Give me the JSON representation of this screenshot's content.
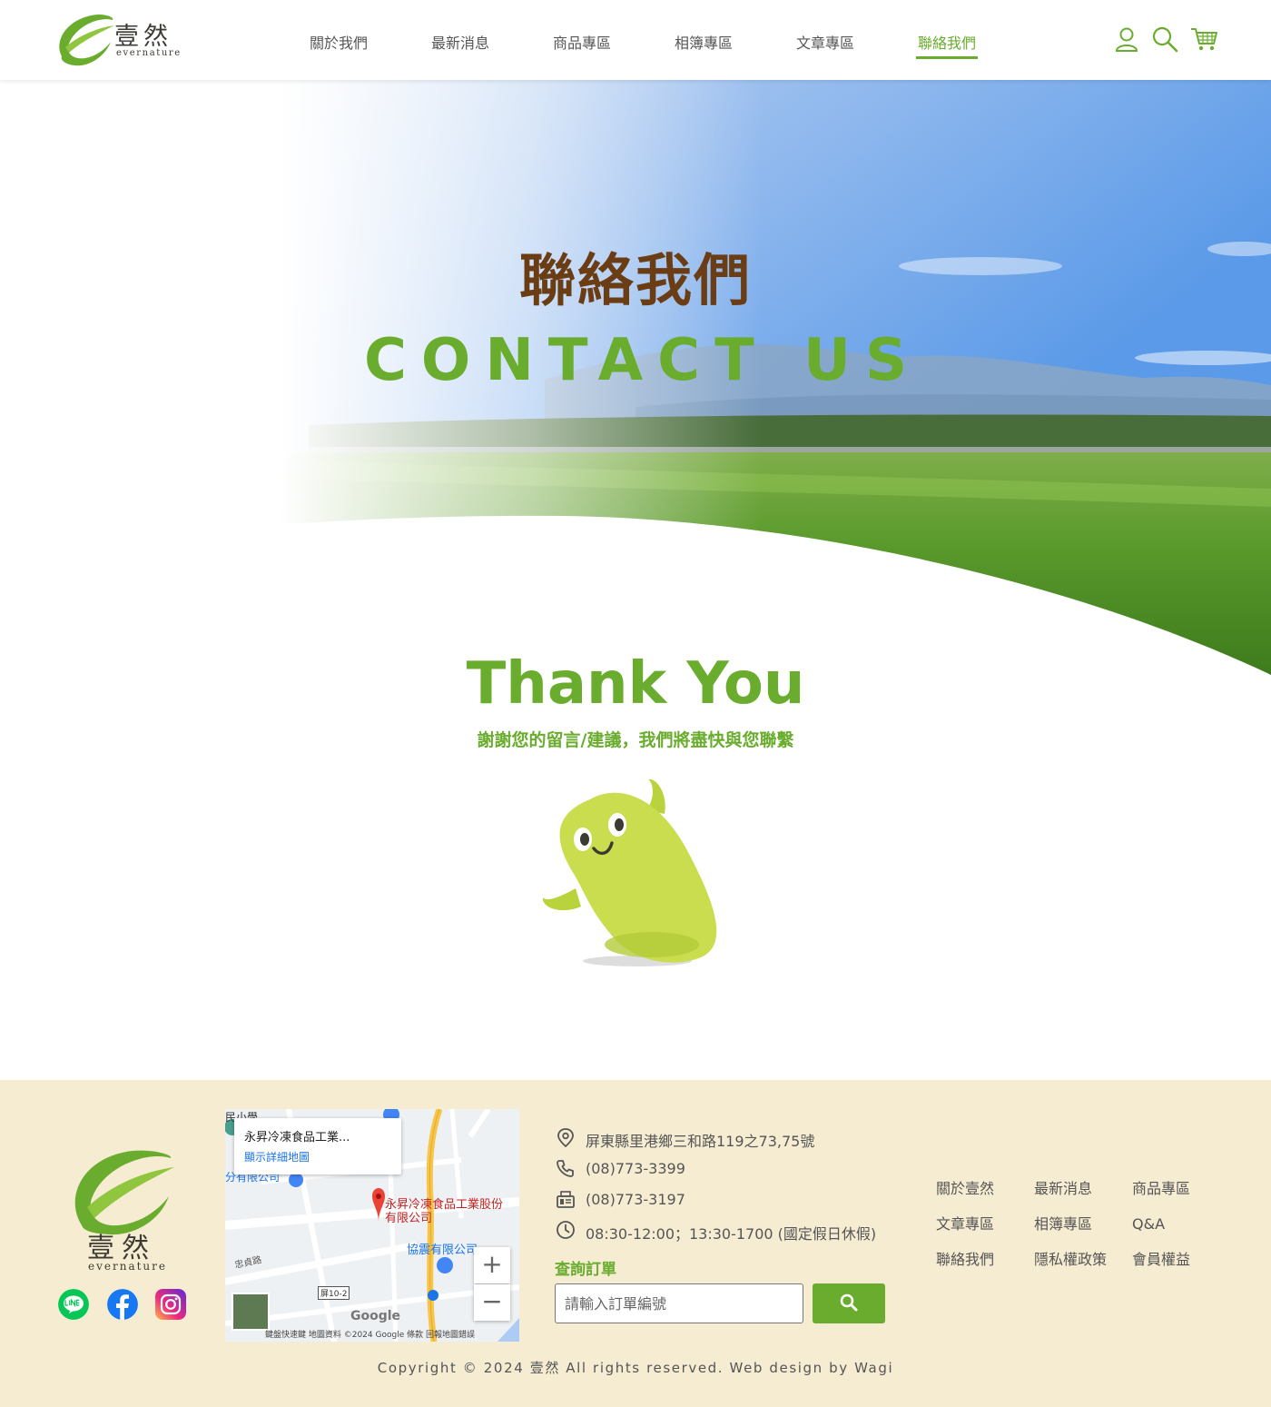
{
  "brand": {
    "name_cn": "壹然",
    "name_en": "evernature"
  },
  "nav": {
    "items": [
      {
        "label": "關於我們",
        "active": false
      },
      {
        "label": "最新消息",
        "active": false
      },
      {
        "label": "商品專區",
        "active": false
      },
      {
        "label": "相簿專區",
        "active": false
      },
      {
        "label": "文章專區",
        "active": false
      },
      {
        "label": "聯絡我們",
        "active": true
      }
    ],
    "icons": [
      "user-icon",
      "search-icon",
      "cart-icon"
    ]
  },
  "hero": {
    "title_cn": "聯絡我們",
    "title_en": "CONTACT US"
  },
  "thanks": {
    "title": "Thank You",
    "subtitle": "謝謝您的留言/建議，我們將盡快與您聯繫"
  },
  "footer": {
    "social": [
      "line-icon",
      "facebook-icon",
      "instagram-icon"
    ],
    "map": {
      "card_title": "永昇冷凍食品工業...",
      "card_link": "顯示詳細地圖",
      "pin_label": "永昇冷凍食品工業股份有限公司",
      "label_shop": "協震有限公司",
      "label_left": "分有限公司",
      "label_top": "民小學",
      "road": "忠貞路",
      "route": "屏10-2",
      "google": "Google",
      "attribution": "鍵盤快速鍵 地圖資料 ©2024 Google 條款 回報地圖錯誤",
      "zoom_in": "+",
      "zoom_out": "−"
    },
    "contact": {
      "address": "屏東縣里港鄉三和路119之73,75號",
      "phone": "(08)773-3399",
      "fax": "(08)773-3197",
      "hours": "08:30-12:00；13:30-1700 (國定假日休假)"
    },
    "order": {
      "title": "查詢訂單",
      "placeholder": "請輸入訂單編號"
    },
    "links": [
      "關於壹然",
      "最新消息",
      "商品專區",
      "文章專區",
      "相簿專區",
      "Q&A",
      "聯絡我們",
      "隱私權政策",
      "會員權益"
    ],
    "copyright": "Copyright © 2024 壹然 All rights reserved. Web design by Wagi"
  },
  "colors": {
    "accent": "#6aad2e",
    "brown": "#6b3d15",
    "footer_bg": "#f5ecd2"
  }
}
